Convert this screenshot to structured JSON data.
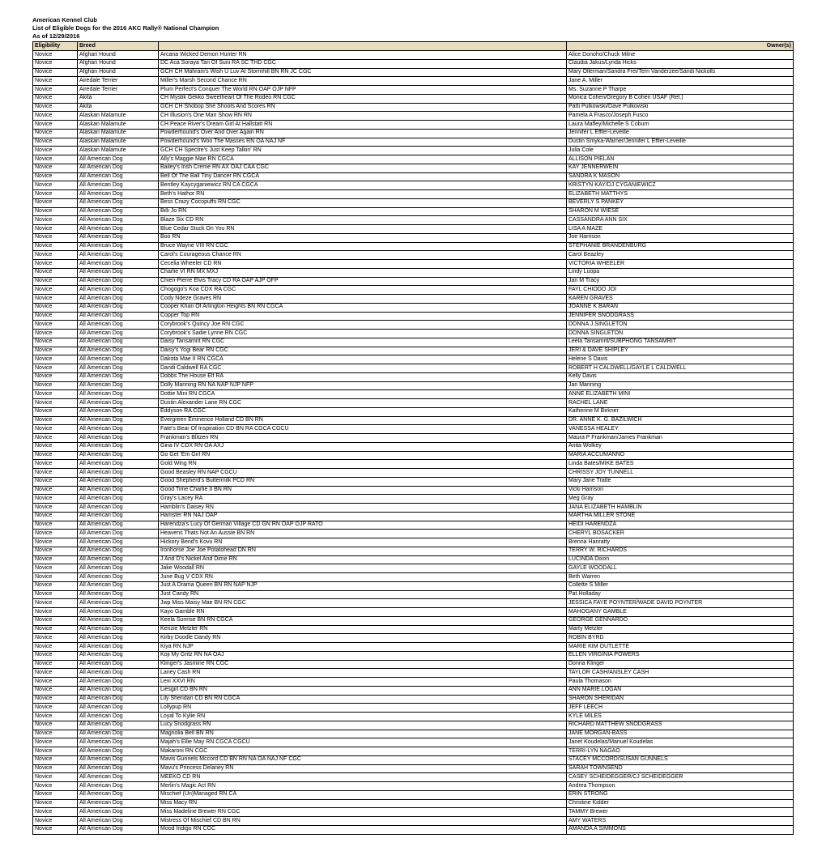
{
  "header": {
    "line1": "American Kennel Club",
    "line2": "List of Eligible Dogs for the 2016 AKC Rally® National Champion",
    "line3": "As of 12/29/2016"
  },
  "columns": [
    "Eligibility",
    "Breed",
    "",
    "Owner(s)"
  ],
  "rows": [
    [
      "Novice",
      "Afghan Hound",
      "Arcana Wicked Demon Hunter  RN",
      "Alice Donoho/Chuck Milne"
    ],
    [
      "Novice",
      "Afghan Hound",
      "DC Aca Soraya Tari Of Suni  RA SC THD CGC",
      "Claudia Jakus/Lynda Hicks"
    ],
    [
      "Novice",
      "Afghan Hound",
      "GCH CH Mahrani's Wish U Luv At Stormhill  BN RN JC CGC",
      "Mary Ollerman/Sandra Frei/Terri Vanderzee/Sandi Nickolls"
    ],
    [
      "Novice",
      "Airedale Terrier",
      "Miller's Marsh Second Chance  RN",
      "Jane A. Miller"
    ],
    [
      "Novice",
      "Airedale Terrier",
      "Plum Perfect's Conquer The World  RN OAP OJP NFP",
      "Ms. Suzanne P Tharpe"
    ],
    [
      "Novice",
      "Akita",
      "CH Mystik Gekko Sweetheart Of The Rodeo  RN CGC",
      "Monica Cohen/Gregory B Cohen USAF (Ret.)"
    ],
    [
      "Novice",
      "Akita",
      "GCH CH Shobop She Shoots And Scores  RN",
      "Patti Pulkowski/Dave Pulkowski"
    ],
    [
      "Novice",
      "Alaskan Malamute",
      "CH Illusion's One Man Show  RN RN",
      "Pamela A Frasco/Joseph Fusco"
    ],
    [
      "Novice",
      "Alaskan Malamute",
      "CH Peace River's Dream Girl At Hallstatt  RN",
      "Laura Mafley/Michelle S Coburn"
    ],
    [
      "Novice",
      "Alaskan Malamute",
      "Powderhound's Over And Over Again  RN",
      "Jennifer L Effler-Leveille"
    ],
    [
      "Novice",
      "Alaskan Malamute",
      "Powderhound's Woo The Masses  RN OA NAJ NF",
      "Dustin Smyka-Warner/Jennifer L Effler-Leveille"
    ],
    [
      "Novice",
      "Alaskan Malamute",
      "GCH CH Spectre's Just Keep Talkin'  RN",
      "Julia Cole"
    ],
    [
      "Novice",
      "All American Dog",
      "Ally's Maggie Mae  RN CGCA",
      "ALLISON PIELAN"
    ],
    [
      "Novice",
      "All American Dog",
      "Bailey's Irish Creme  RN AX OAJ CAA CGC",
      "KAY JENNERWEIN"
    ],
    [
      "Novice",
      "All American Dog",
      "Bell Of The Ball Tiny Dancer  RN CGCA",
      "SANDRA K MASON"
    ],
    [
      "Novice",
      "All American Dog",
      "Bentley Kaycyganiewicz  RN CA CGCA",
      "KRISTYN KAY/DJ CYGANIEWICZ"
    ],
    [
      "Novice",
      "All American Dog",
      "Beth's Hathor  RN",
      "ELIZABETH MATTHYS"
    ],
    [
      "Novice",
      "All American Dog",
      "Bess Crazy Cocopuffs  RN CGC",
      "BEVERLY S PANKEY"
    ],
    [
      "Novice",
      "All American Dog",
      "Billi Jo  RN",
      "SHARON M WIESE"
    ],
    [
      "Novice",
      "All American Dog",
      "Blaze Six  CD RN",
      "CASSANDRA ANN SIX"
    ],
    [
      "Novice",
      "All American Dog",
      "Blue Cedar Stuck On You  RN",
      "LISA A MAZE"
    ],
    [
      "Novice",
      "All American Dog",
      "Boo  RN",
      "Joe Harrison"
    ],
    [
      "Novice",
      "All American Dog",
      "Bruce Wayne VIII RN CGC",
      "STEPHANIE BRANDENBURG"
    ],
    [
      "Novice",
      "All American Dog",
      "Carol's Courageous Chance  RN",
      "Carol Beazley"
    ],
    [
      "Novice",
      "All American Dog",
      "Cecelia Wheeler  CD RN",
      "VICTORIA WHEELER"
    ],
    [
      "Novice",
      "All American Dog",
      "Charlie VI RN MX MXJ",
      "Lindy Luopa"
    ],
    [
      "Novice",
      "All American Dog",
      "Chien-Pierre Elvis Tracy  CD RA OAP AJP OFP",
      "Jan M Tracy"
    ],
    [
      "Novice",
      "All American Dog",
      "Chogogo's Koa  CDX RA CGC",
      "FAYL CHIODO JOI"
    ],
    [
      "Novice",
      "All American Dog",
      "Cody Ndeze Graves  RN",
      "KAREN GRAVES"
    ],
    [
      "Novice",
      "All American Dog",
      "Cooper Khan Of Arlington Heights  BN RN CGCA",
      "JOANNE K BARAN"
    ],
    [
      "Novice",
      "All American Dog",
      "Copper Top  RN",
      "JENNIFER SNODGRASS"
    ],
    [
      "Novice",
      "All American Dog",
      "Corybrook's Quincy Joe  RN CGC",
      "DONNA J SINGLETON"
    ],
    [
      "Novice",
      "All American Dog",
      "Corybrook's Sadie Lynne  RN CGC",
      "DONNA SINGLETON"
    ],
    [
      "Novice",
      "All American Dog",
      "Daisy Tansamrit  RN CGC",
      "Leela Tansamrit/SUBPHONG TANSAMRIT"
    ],
    [
      "Novice",
      "All American Dog",
      "Daisy's Yogi Bear  RN CGC",
      "JERI & DAVE SHIPLEY"
    ],
    [
      "Novice",
      "All American Dog",
      "Dakota Mae II RN CGCA",
      "Helene S Davis"
    ],
    [
      "Novice",
      "All American Dog",
      "Dandi Caldwell RA CGC",
      "ROBERT H CALDWELL/GAYLE L CALDWELL"
    ],
    [
      "Novice",
      "All American Dog",
      "Dobbs The House Elf  RA",
      "Kelly Davis"
    ],
    [
      "Novice",
      "All American Dog",
      "Dolly Manning  RN NA NAP NJP NFP",
      "Jan Manning"
    ],
    [
      "Novice",
      "All American Dog",
      "Dottie Mini  RN CGCA",
      "ANNE ELIZABETH MINI"
    ],
    [
      "Novice",
      "All American Dog",
      "Dustin Alexander Lane  RN CGC",
      "RACHEL LANE"
    ],
    [
      "Novice",
      "All American Dog",
      "Eddyson  RA CGC",
      "Katherine M Birkner"
    ],
    [
      "Novice",
      "All American Dog",
      "Evergreen Eminence Holland  CD BN RN",
      "DR. ANNE K. G. BAZILWICH"
    ],
    [
      "Novice",
      "All American Dog",
      "Fate's Bear Of Inspiration  CD BN RA CGCA CGCU",
      "VANESSA HEALEY"
    ],
    [
      "Novice",
      "All American Dog",
      "Frankman's Blitzen  RN",
      "Maura P Frankman/James Frankman"
    ],
    [
      "Novice",
      "All American Dog",
      "Gina IV CDX RN OA AXJ",
      "Anita Wolkey"
    ],
    [
      "Novice",
      "All American Dog",
      "Go Get 'Em Girl  RN",
      "MARIA ACCUMANNO"
    ],
    [
      "Novice",
      "All American Dog",
      "Gold Wing  RN",
      "Linda Bates/MIKE BATES"
    ],
    [
      "Novice",
      "All American Dog",
      "Good Beasley  RN NAP CGCU",
      "CHRISSY JOY TUNNELL"
    ],
    [
      "Novice",
      "All American Dog",
      "Good Shepherd's Buttermilk  PCD RN",
      "Mary Jane Tratte"
    ],
    [
      "Novice",
      "All American Dog",
      "Good Time Charlie II BN RN",
      "Vicki Harrison"
    ],
    [
      "Novice",
      "All American Dog",
      "Gray's Lacey  RA",
      "Meg Gray"
    ],
    [
      "Novice",
      "All American Dog",
      "Hamblin's Daisey  RN",
      "JANA ELIZABETH HAMBLIN"
    ],
    [
      "Novice",
      "All American Dog",
      "Hamster  RN NAJ OAP",
      "MARTHA MILLER STONE"
    ],
    [
      "Novice",
      "All American Dog",
      "Harendza's Lucy Of German Village  CD GN RN OAP OJP RATO",
      "HEIDI HARENDZA"
    ],
    [
      "Novice",
      "All American Dog",
      "Heavens Thats Not An Aussie  BN RN",
      "CHERYL BOSACKER"
    ],
    [
      "Novice",
      "All American Dog",
      "Hickory Bend's Kovu  RN",
      "Brenna Hanratty"
    ],
    [
      "Novice",
      "All American Dog",
      "Ironhorse Joe Joe Potatohead  DN RN",
      "TERRY W. RICHARDS"
    ],
    [
      "Novice",
      "All American Dog",
      "J And D's Nickel And Dime  RN",
      "LUCINDA Dixon"
    ],
    [
      "Novice",
      "All American Dog",
      "Jake Woodall  RN",
      "GAYLE WOODALL"
    ],
    [
      "Novice",
      "All American Dog",
      "June Bug V CDX RN",
      "Beth Warren"
    ],
    [
      "Novice",
      "All American Dog",
      "Just A Drama Queen  BN RN NAP NJP",
      "Collette S Miller"
    ],
    [
      "Novice",
      "All American Dog",
      "Just Candy  RN",
      "Pat Holladay"
    ],
    [
      "Novice",
      "All American Dog",
      "Jwp Miss Maisy Mae  BN RN CGC",
      "JESSICA FAYE POYNTER/WADE DAVID POYNTER"
    ],
    [
      "Novice",
      "All American Dog",
      "Kayo Gamble  RN",
      "MAHOGANY GAMBLE"
    ],
    [
      "Novice",
      "All American Dog",
      "Keela Sunrise  BN RN CGCA",
      "GEORGE GENNARDO"
    ],
    [
      "Novice",
      "All American Dog",
      "Kenzie Metzler  RN",
      "Marty Metzler"
    ],
    [
      "Novice",
      "All American Dog",
      "Kirby Doodle Dandy  RN",
      "ROBIN BYRD"
    ],
    [
      "Novice",
      "All American Dog",
      "Kiya  RN NJP",
      "MARIE KIM OUTLETTE"
    ],
    [
      "Novice",
      "All American Dog",
      "Koji My Gritz  RN NA OAJ",
      "ELLEN VIRGINIA POWERS"
    ],
    [
      "Novice",
      "All American Dog",
      "Klinger's Jasmine  RN CGC",
      "Donna Klinger"
    ],
    [
      "Novice",
      "All American Dog",
      "Laney Cash  RN",
      "TAYLOR CASH/ANSLEY CASH"
    ],
    [
      "Novice",
      "All American Dog",
      "Lexi XXVI RN",
      "Paula Thomason"
    ],
    [
      "Novice",
      "All American Dog",
      "Liesgirl  CD BN RN",
      "ANN MARIE LOGAN"
    ],
    [
      "Novice",
      "All American Dog",
      "Lily Sheridan  CD BN RN CGCA",
      "SHARON SHERIDAN"
    ],
    [
      "Novice",
      "All American Dog",
      "Lollypup  RN",
      "JEFF LEECH"
    ],
    [
      "Novice",
      "All American Dog",
      "Loyal To Kylie  RN",
      "KYLE MILES"
    ],
    [
      "Novice",
      "All American Dog",
      "Lucy Snodgrass  RN",
      "RICHARD MATTHEW SNODGRASS"
    ],
    [
      "Novice",
      "All American Dog",
      "Magnolia Bell  BN RN",
      "JANE MORGAN-BASS"
    ],
    [
      "Novice",
      "All American Dog",
      "Majah's Ellie May  RN CGCA CGCU",
      "Janet Koudelas/Manuel Koudelas"
    ],
    [
      "Novice",
      "All American Dog",
      "Makaroni  RN CGC",
      "TERRI-LYN NAGAO"
    ],
    [
      "Novice",
      "All American Dog",
      "Mavis Gunnels Mccord  CD BN RN NA OA NAJ NF CGC",
      "STACEY MCCORD/SUSAN GUNNELS"
    ],
    [
      "Novice",
      "All American Dog",
      "Mavu's Princess Delaney  RN",
      "SARAH TOWNSEND"
    ],
    [
      "Novice",
      "All American Dog",
      "MEEKO  CD RN",
      "CASEY SCHEIDEGGER/CJ SCHEIDEGGER"
    ],
    [
      "Novice",
      "All American Dog",
      "Merlin's Magic Act  RN",
      "Andrea Thompson"
    ],
    [
      "Novice",
      "All American Dog",
      "Mischief (Un)Managed  RN CA",
      "ERIN STRONG"
    ],
    [
      "Novice",
      "All American Dog",
      "Miss Macy  RN",
      "Christine Kidder"
    ],
    [
      "Novice",
      "All American Dog",
      "Miss Madeline Brewer  RN CGC",
      "TAMMY Brewer"
    ],
    [
      "Novice",
      "All American Dog",
      "Mistress Of Mischief  CD BN RN",
      "AMY WATERS"
    ],
    [
      "Novice",
      "All American Dog",
      "Mood Indigo  RN CGC",
      "AMANDA A SIMMONS"
    ]
  ]
}
